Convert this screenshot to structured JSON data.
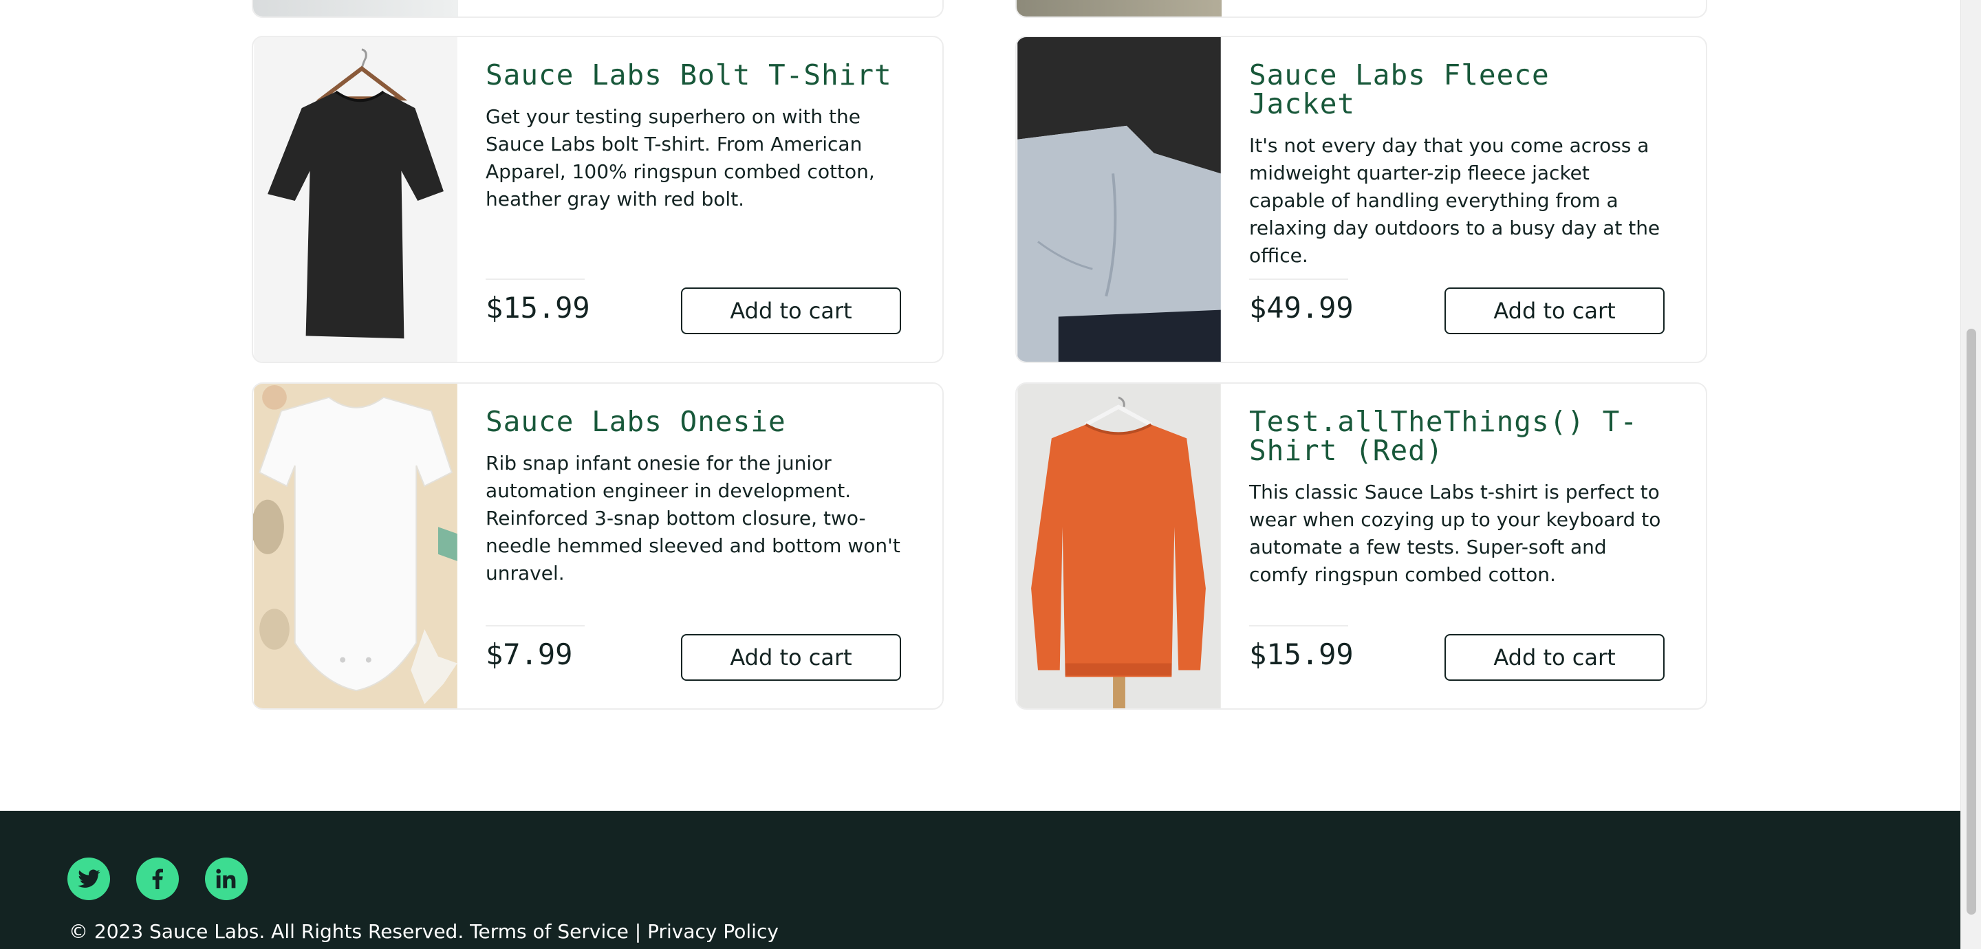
{
  "products": [
    {
      "name": "Sauce Labs Bolt T-Shirt",
      "description": "Get your testing superhero on with the Sauce Labs bolt T-shirt. From American Apparel, 100% ringspun combed cotton, heather gray with red bolt.",
      "price": "$15.99",
      "button_label": "Add to cart",
      "image_icon": "black-tshirt-image"
    },
    {
      "name": "Sauce Labs Fleece Jacket",
      "description": "It's not every day that you come across a midweight quarter-zip fleece jacket capable of handling everything from a relaxing day outdoors to a busy day at the office.",
      "price": "$49.99",
      "button_label": "Add to cart",
      "image_icon": "fleece-jacket-image"
    },
    {
      "name": "Sauce Labs Onesie",
      "description": "Rib snap infant onesie for the junior automation engineer in development. Reinforced 3-snap bottom closure, two-needle hemmed sleeved and bottom won't unravel.",
      "price": "$7.99",
      "button_label": "Add to cart",
      "image_icon": "onesie-image"
    },
    {
      "name": "Test.allTheThings() T-Shirt (Red)",
      "description": "This classic Sauce Labs t-shirt is perfect to wear when cozying up to your keyboard to automate a few tests. Super-soft and comfy ringspun combed cotton.",
      "price": "$15.99",
      "button_label": "Add to cart",
      "image_icon": "red-sweatshirt-image"
    }
  ],
  "footer": {
    "copyright": "© 2023 Sauce Labs. All Rights Reserved. Terms of Service | Privacy Policy",
    "social": [
      "twitter-icon",
      "facebook-icon",
      "linkedin-icon"
    ]
  },
  "colors": {
    "title": "#18583a",
    "footer_bg": "#132322",
    "social": "#3ddc91"
  }
}
